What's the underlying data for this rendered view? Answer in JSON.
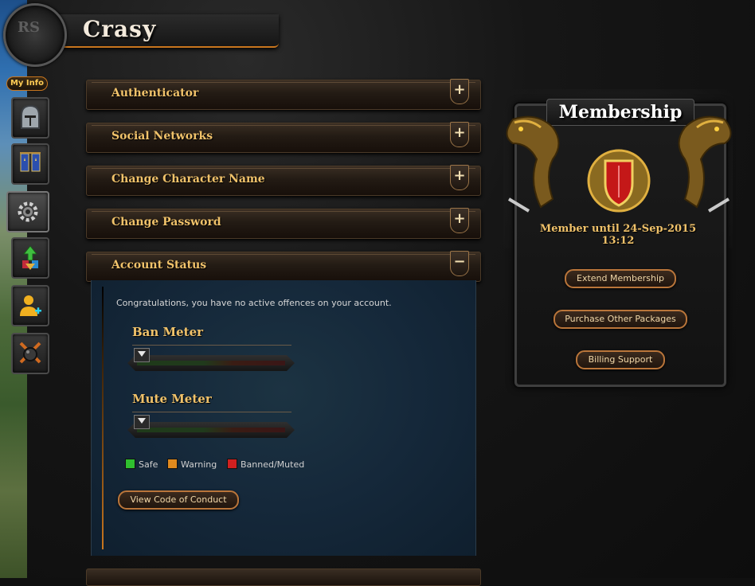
{
  "header": {
    "username": "Crasy",
    "avatar_text": "RS"
  },
  "nav": {
    "my_info_label": "My Info",
    "items": [
      {
        "icon": "helmet-icon"
      },
      {
        "icon": "banner-icon"
      },
      {
        "icon": "gear-icon"
      },
      {
        "icon": "gem-upgrade-icon"
      },
      {
        "icon": "add-friend-icon"
      },
      {
        "icon": "bomb-icon"
      }
    ]
  },
  "sections": [
    {
      "label": "Authenticator",
      "toggle": "+"
    },
    {
      "label": "Social Networks",
      "toggle": "+"
    },
    {
      "label": "Change Character Name",
      "toggle": "+"
    },
    {
      "label": "Change Password",
      "toggle": "+"
    },
    {
      "label": "Account Status",
      "toggle": "−"
    }
  ],
  "account_status": {
    "message": "Congratulations, you have no active offences on your account.",
    "ban_meter_title": "Ban Meter",
    "mute_meter_title": "Mute Meter",
    "ban_level": 0,
    "mute_level": 0,
    "legend": [
      {
        "label": "Safe",
        "color": "#2fbf2f"
      },
      {
        "label": "Warning",
        "color": "#e08a1e"
      },
      {
        "label": "Banned/Muted",
        "color": "#d02020"
      }
    ],
    "conduct_button": "View Code of Conduct"
  },
  "membership": {
    "title": "Membership",
    "until": "Member until 24-Sep-2015 13:12",
    "buttons": {
      "extend": "Extend Membership",
      "purchase": "Purchase Other Packages",
      "billing": "Billing Support"
    }
  }
}
